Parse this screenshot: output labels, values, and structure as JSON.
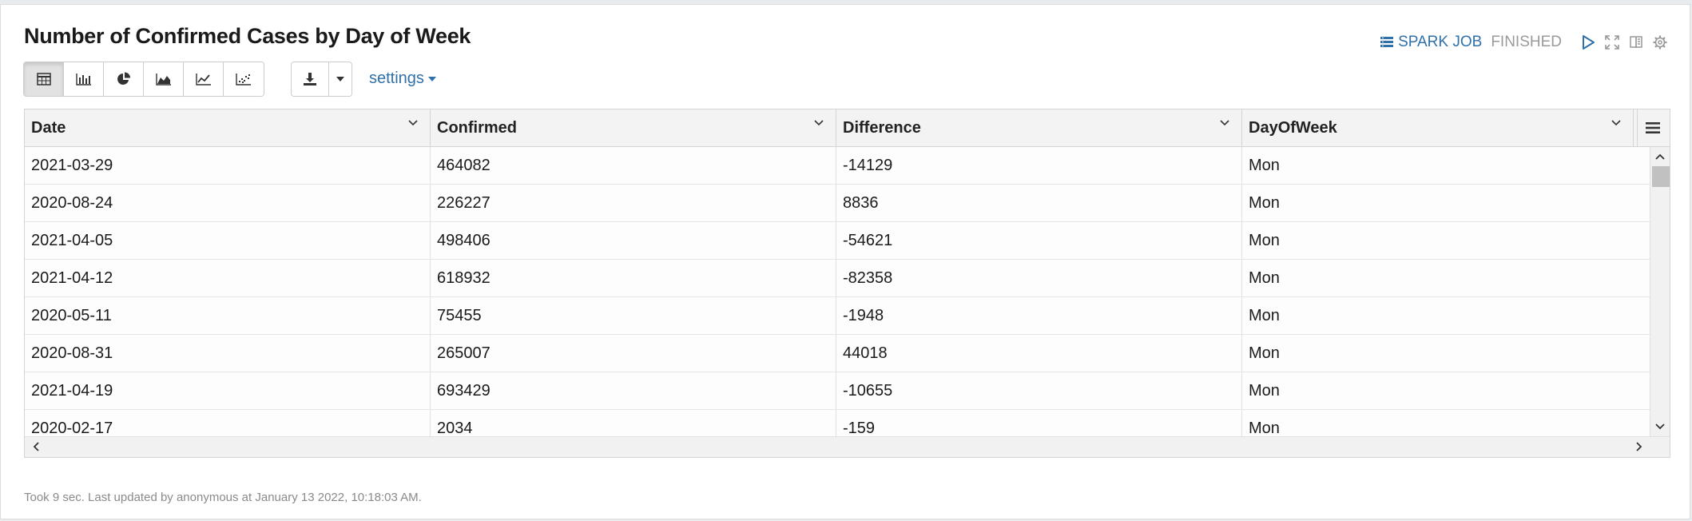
{
  "paragraph": {
    "title": "Number of Confirmed Cases by Day of Week",
    "spark_job_label": "SPARK JOB",
    "status": "FINISHED",
    "settings_label": "settings",
    "footer": "Took 9 sec. Last updated by anonymous at January 13 2022, 10:18:03 AM."
  },
  "toolbar": {
    "viz_buttons": [
      "table-icon",
      "bar-chart-icon",
      "pie-chart-icon",
      "area-chart-icon",
      "line-chart-icon",
      "scatter-chart-icon"
    ],
    "active": "table-icon"
  },
  "table": {
    "columns": [
      "Date",
      "Confirmed",
      "Difference",
      "DayOfWeek"
    ],
    "rows": [
      [
        "2021-03-29",
        "464082",
        "-14129",
        "Mon"
      ],
      [
        "2020-08-24",
        "226227",
        "8836",
        "Mon"
      ],
      [
        "2021-04-05",
        "498406",
        "-54621",
        "Mon"
      ],
      [
        "2021-04-12",
        "618932",
        "-82358",
        "Mon"
      ],
      [
        "2020-05-11",
        "75455",
        "-1948",
        "Mon"
      ],
      [
        "2020-08-31",
        "265007",
        "44018",
        "Mon"
      ],
      [
        "2021-04-19",
        "693429",
        "-10655",
        "Mon"
      ],
      [
        "2020-02-17",
        "2034",
        "-159",
        "Mon"
      ]
    ]
  },
  "colors": {
    "link": "#3071a9",
    "status": "#9a9a9a",
    "header_bg": "#f3f3f3"
  }
}
